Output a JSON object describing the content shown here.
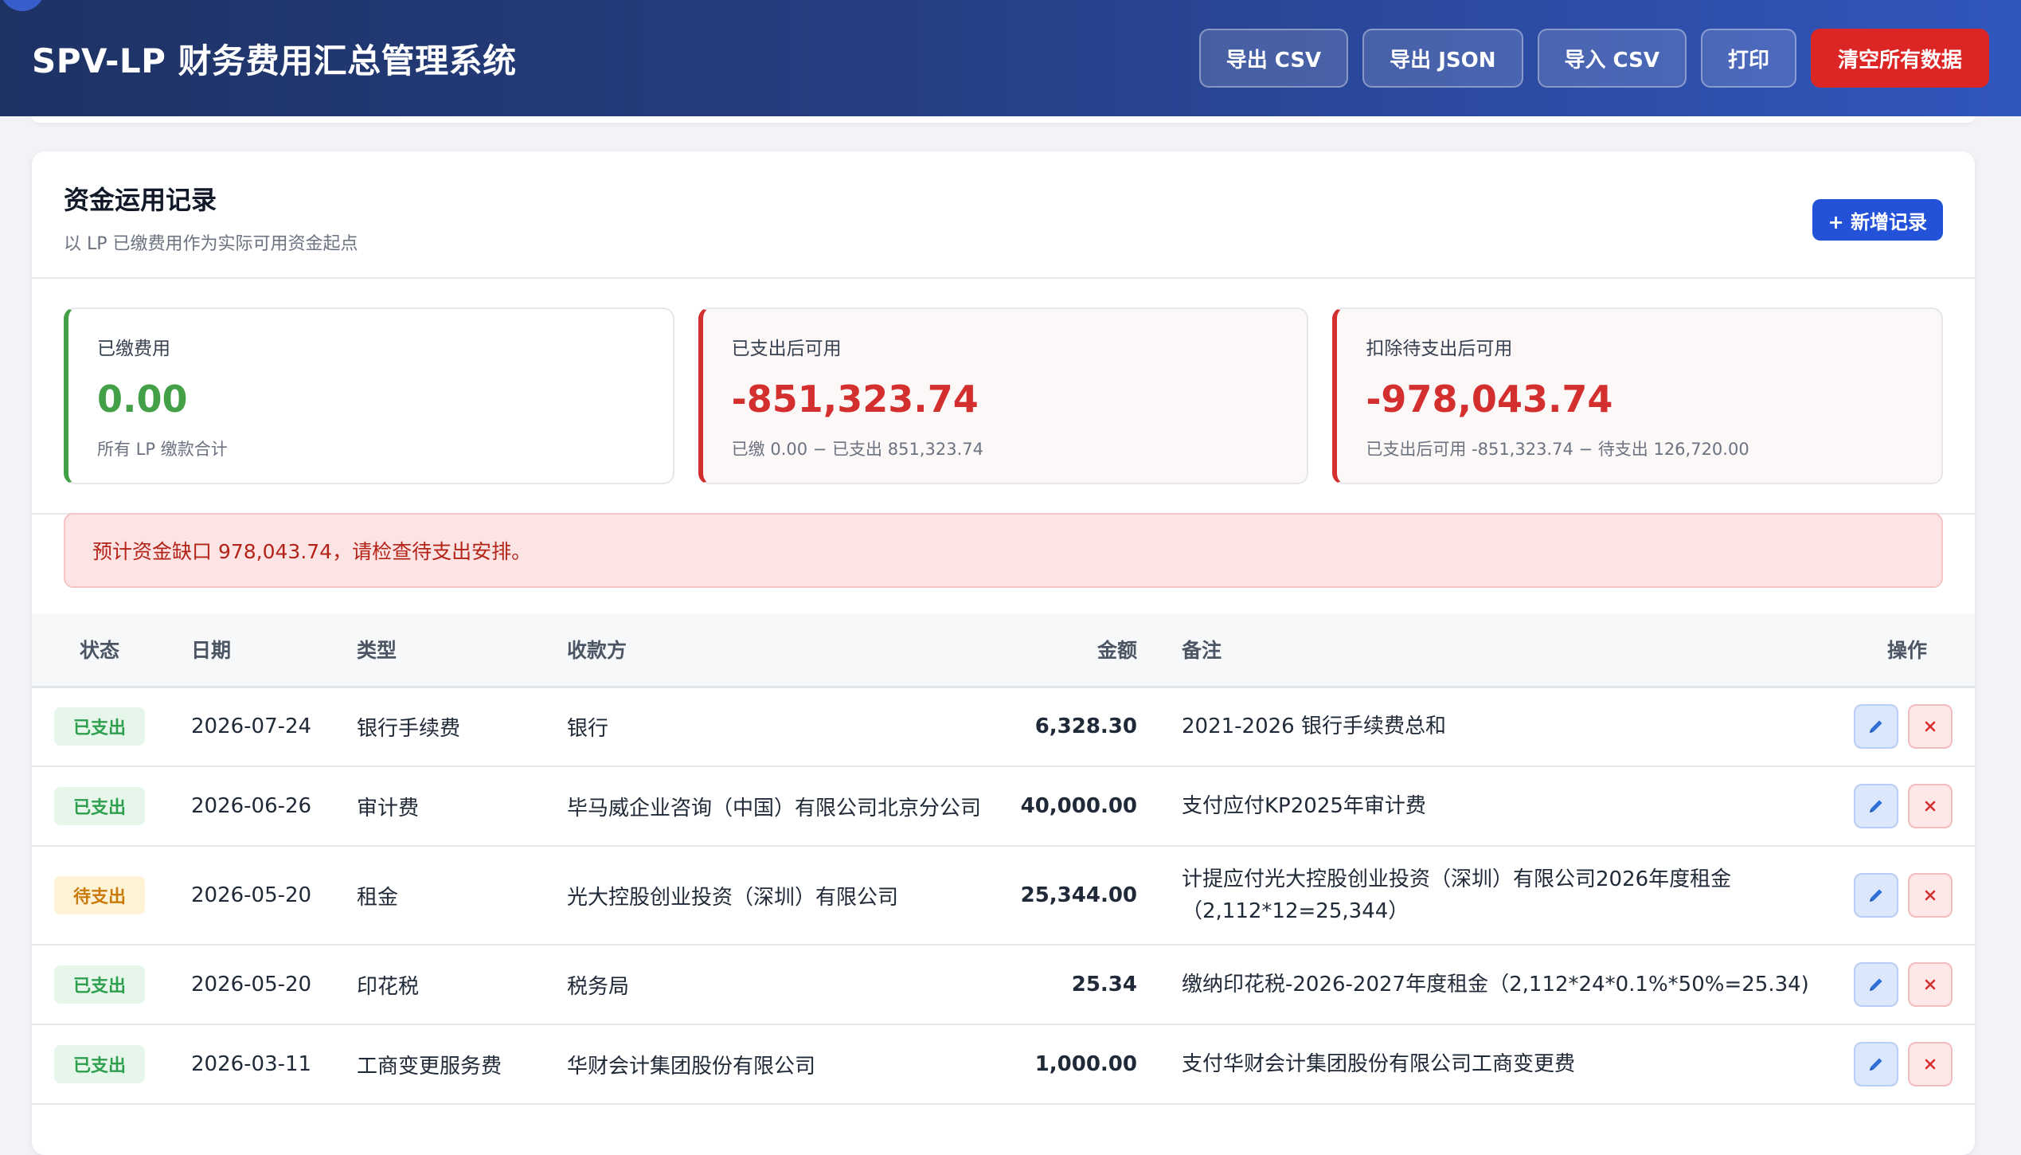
{
  "header": {
    "title": "SPV-LP 财务费用汇总管理系统",
    "buttons": {
      "export_csv": "导出 CSV",
      "export_json": "导出 JSON",
      "import_csv": "导入 CSV",
      "print": "打印",
      "clear_all": "清空所有数据"
    }
  },
  "section": {
    "title": "资金运用记录",
    "subtitle": "以 LP 已缴费用作为实际可用资金起点",
    "add_button": "+ 新增记录"
  },
  "stats": [
    {
      "label": "已缴费用",
      "value": "0.00",
      "note": "所有 LP 缴款合计"
    },
    {
      "label": "已支出后可用",
      "value": "-851,323.74",
      "note": "已缴 0.00 − 已支出 851,323.74"
    },
    {
      "label": "扣除待支出后可用",
      "value": "-978,043.74",
      "note": "已支出后可用 -851,323.74 − 待支出 126,720.00"
    }
  ],
  "alert": {
    "text": "预计资金缺口 978,043.74，请检查待支出安排。"
  },
  "table": {
    "headers": {
      "status": "状态",
      "date": "日期",
      "type": "类型",
      "payee": "收款方",
      "amount": "金额",
      "note": "备注",
      "ops": "操作"
    },
    "rows": [
      {
        "status": "已支出",
        "date": "2026-07-24",
        "type": "银行手续费",
        "payee": "银行",
        "amount": "6,328.30",
        "note1": "2021-2026 银行手续费总和",
        "note2": ""
      },
      {
        "status": "已支出",
        "date": "2026-06-26",
        "type": "审计费",
        "payee": "毕马威企业咨询（中国）有限公司北京分公司",
        "amount": "40,000.00",
        "note1": "支付应付KP2025年审计费",
        "note2": ""
      },
      {
        "status": "待支出",
        "date": "2026-05-20",
        "type": "租金",
        "payee": "光大控股创业投资（深圳）有限公司",
        "amount": "25,344.00",
        "note1": "计提应付光大控股创业投资（深圳）有限公司2026年度租金",
        "note2": "（2,112*12=25,344）"
      },
      {
        "status": "已支出",
        "date": "2026-05-20",
        "type": "印花税",
        "payee": "税务局",
        "amount": "25.34",
        "note1": "缴纳印花税-2026-2027年度租金（2,112*24*0.1%*50%=25.34)",
        "note2": ""
      },
      {
        "status": "已支出",
        "date": "2026-03-11",
        "type": "工商变更服务费",
        "payee": "华财会计集团股份有限公司",
        "amount": "1,000.00",
        "note1": "支付华财会计集团股份有限公司工商变更费",
        "note2": ""
      }
    ]
  },
  "colors": {
    "header_start": "#1e3264",
    "header_end": "#3156bd",
    "danger": "#dc2626",
    "positive": "#43a047",
    "negative": "#d32f2f",
    "badge_paid": "#2e9e4f",
    "badge_pending": "#c97a0a"
  },
  "icons": {
    "edit": "pencil-icon",
    "delete": "close-icon"
  }
}
